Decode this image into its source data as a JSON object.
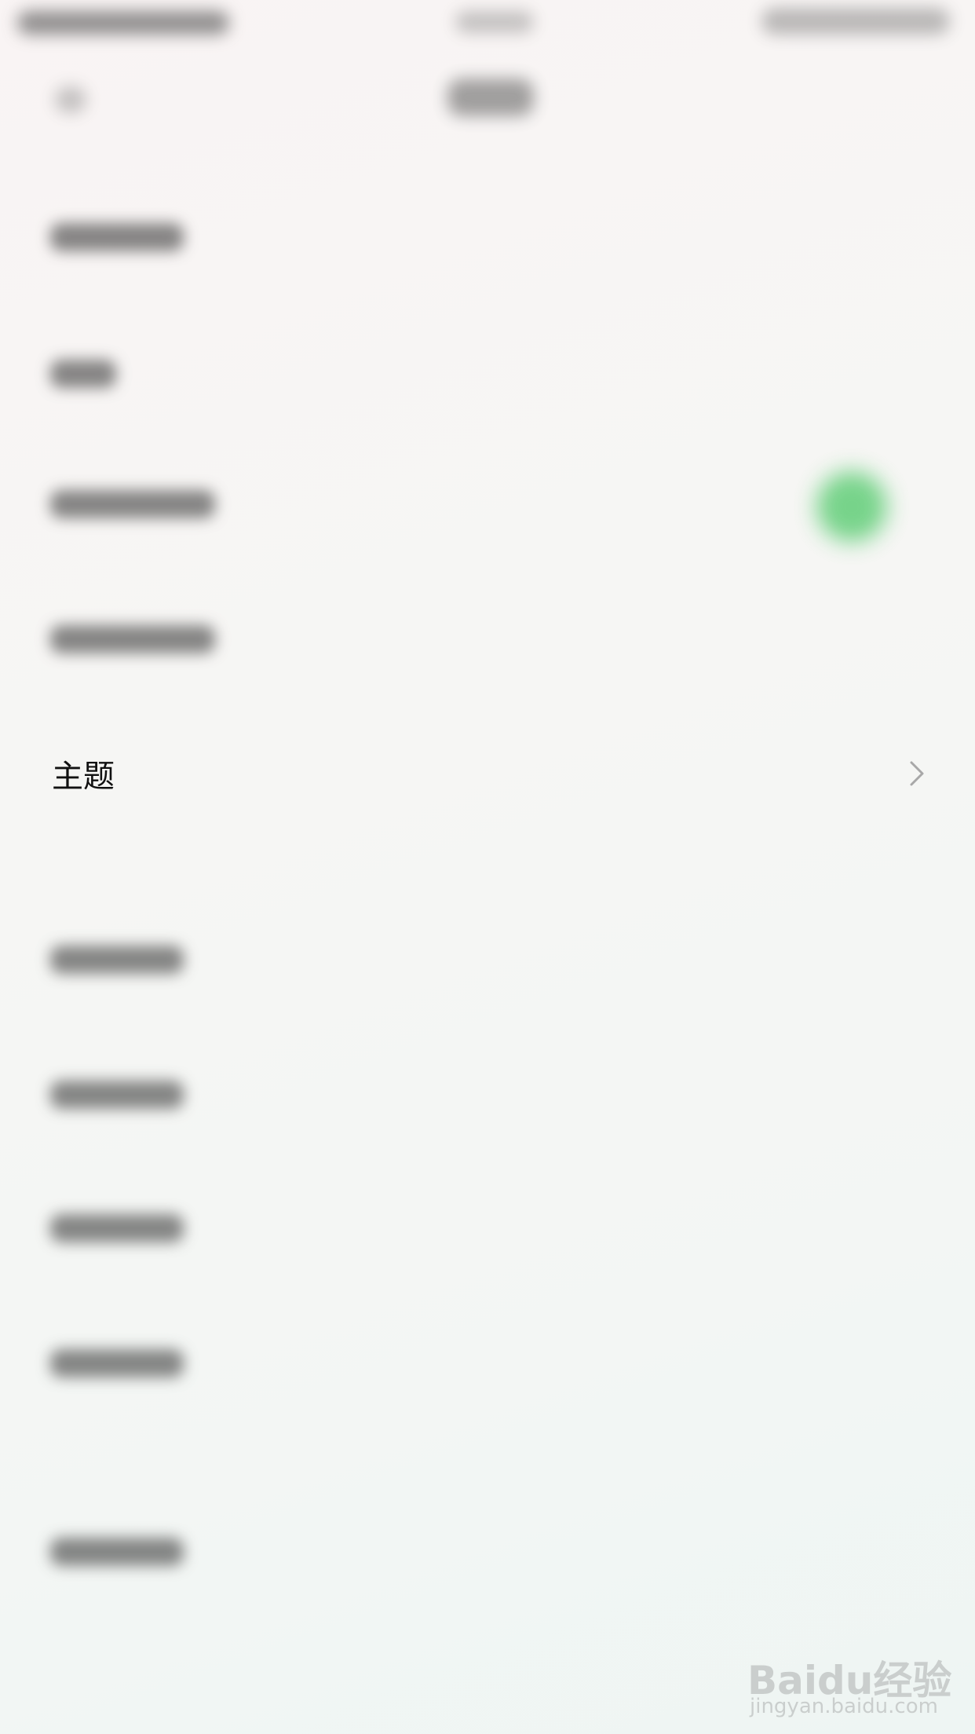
{
  "settings_row": {
    "label": "主题"
  },
  "watermark": {
    "logo": "Baidu经验",
    "url": "jingyan.baidu.com"
  },
  "colors": {
    "toggle_on": "#6ad07f",
    "text_primary": "#111111",
    "chevron": "#a8a8a8"
  },
  "icons": {
    "back": "back-icon",
    "chevron": "chevron-right-icon",
    "toggle": "toggle-on-icon"
  }
}
